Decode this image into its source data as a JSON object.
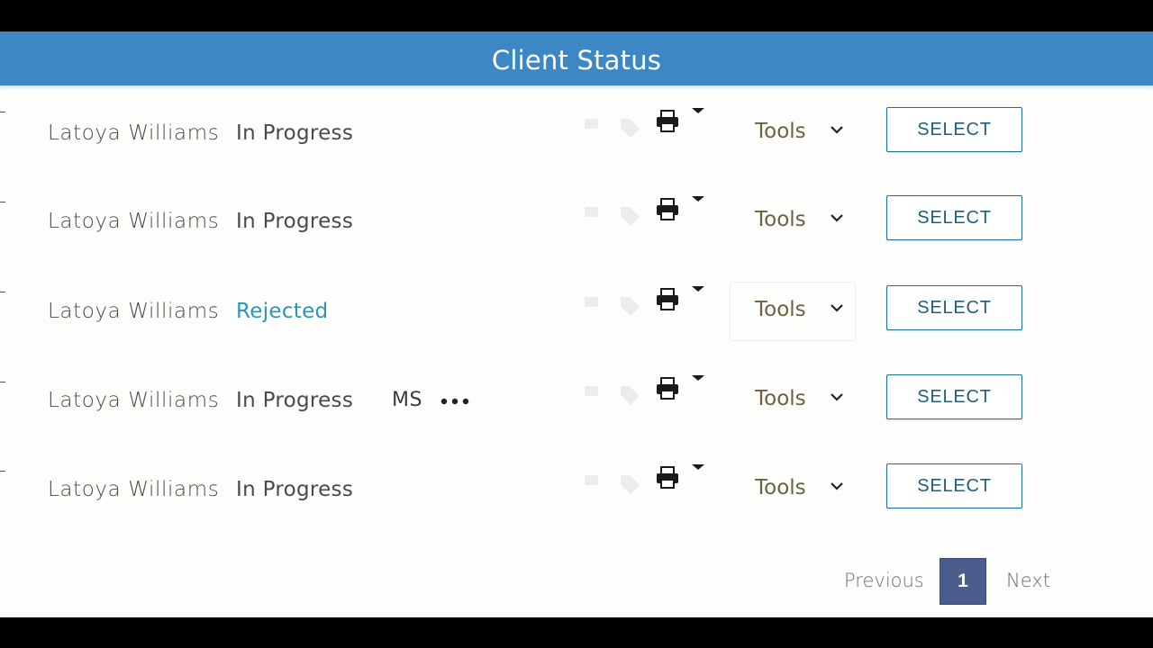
{
  "header": {
    "title": "Client Status"
  },
  "rows": [
    {
      "name": "Latoya Williams",
      "status": "In Progress",
      "tools_label": "Tools",
      "select_label": "SELECT"
    },
    {
      "name": "Latoya Williams",
      "status": "In Progress",
      "tools_label": "Tools",
      "select_label": "SELECT"
    },
    {
      "name": "Latoya Williams",
      "status": "Rejected",
      "tools_label": "Tools",
      "select_label": "SELECT"
    },
    {
      "name": "Latoya Williams",
      "status": "In Progress",
      "initials": "MS",
      "tools_label": "Tools",
      "select_label": "SELECT"
    },
    {
      "name": "Latoya Williams",
      "status": "In Progress",
      "tools_label": "Tools",
      "select_label": "SELECT"
    }
  ],
  "pagination": {
    "previous": "Previous",
    "current_page": "1",
    "next": "Next"
  },
  "icons": {
    "flag": "flag-icon",
    "tag": "tag-icon",
    "print": "print-icon",
    "caret": "caret-down-icon",
    "chevron": "chevron-down-icon",
    "more": "more-horizontal-icon"
  },
  "colors": {
    "header_bg": "#3d87c4",
    "rejected_status": "#2e95b5",
    "select_border": "#1f6f8f",
    "page_active_bg": "#4a5d8c"
  }
}
